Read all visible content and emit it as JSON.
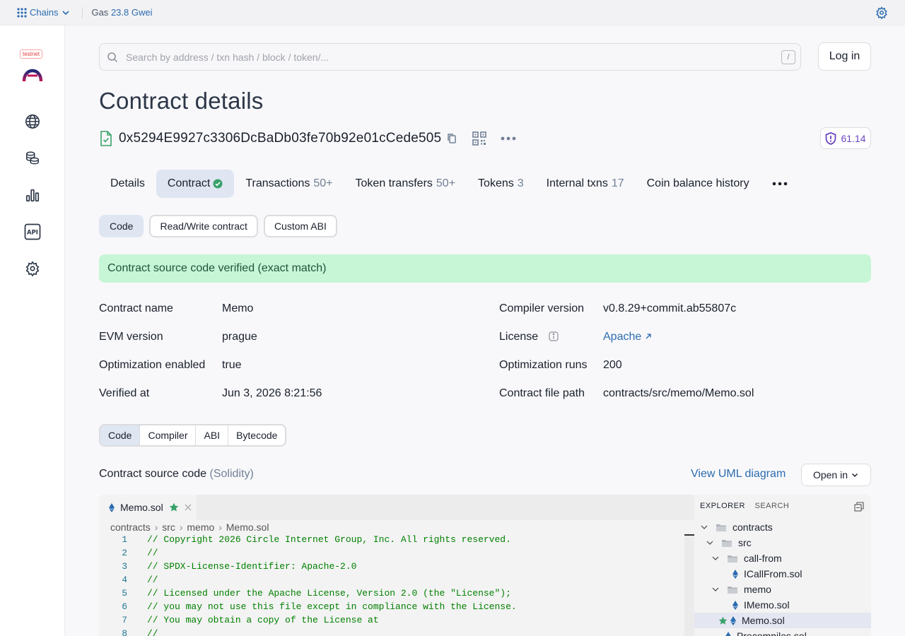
{
  "topbar": {
    "chains_label": "Chains",
    "gas_label": "Gas",
    "gas_value": "23.8 Gwei"
  },
  "sidebar": {
    "badge": "testnet"
  },
  "search": {
    "placeholder": "Search by address / txn hash / block / token/...",
    "shortcut": "/"
  },
  "header": {
    "login": "Log in",
    "title": "Contract details"
  },
  "contract": {
    "address": "0x5294E9927c3306DcBaDb03fe70b92e01cCede505",
    "score": "61.14"
  },
  "tabs": [
    {
      "label": "Details",
      "count": ""
    },
    {
      "label": "Contract",
      "count": ""
    },
    {
      "label": "Transactions",
      "count": "50+"
    },
    {
      "label": "Token transfers",
      "count": "50+"
    },
    {
      "label": "Tokens",
      "count": "3"
    },
    {
      "label": "Internal txns",
      "count": "17"
    },
    {
      "label": "Coin balance history",
      "count": ""
    }
  ],
  "subtabs": [
    "Code",
    "Read/Write contract",
    "Custom ABI"
  ],
  "verified_msg": "Contract source code verified (exact match)",
  "details": {
    "left": [
      {
        "k": "Contract name",
        "v": "Memo"
      },
      {
        "k": "EVM version",
        "v": "prague"
      },
      {
        "k": "Optimization enabled",
        "v": "true"
      },
      {
        "k": "Verified at",
        "v": "Jun 3, 2026 8:21:56"
      }
    ],
    "right": [
      {
        "k": "Compiler version",
        "v": "v0.8.29+commit.ab55807c"
      },
      {
        "k": "License",
        "v": "Apache"
      },
      {
        "k": "Optimization runs",
        "v": "200"
      },
      {
        "k": "Contract file path",
        "v": "contracts/src/memo/Memo.sol"
      }
    ]
  },
  "segments": [
    "Code",
    "Compiler",
    "ABI",
    "Bytecode"
  ],
  "source": {
    "title": "Contract source code",
    "lang": "(Solidity)",
    "uml": "View UML diagram",
    "open_in": "Open in"
  },
  "editor": {
    "tab": "Memo.sol",
    "breadcrumb": [
      "contracts",
      "src",
      "memo",
      "Memo.sol"
    ],
    "lines": [
      {
        "n": "1",
        "t": "// Copyright 2026 Circle Internet Group, Inc. All rights reserved."
      },
      {
        "n": "2",
        "t": "//"
      },
      {
        "n": "3",
        "t": "// SPDX-License-Identifier: Apache-2.0"
      },
      {
        "n": "4",
        "t": "//"
      },
      {
        "n": "5",
        "t": "// Licensed under the Apache License, Version 2.0 (the \"License\");"
      },
      {
        "n": "6",
        "t": "// you may not use this file except in compliance with the License."
      },
      {
        "n": "7",
        "t": "// You may obtain a copy of the License at"
      },
      {
        "n": "8",
        "t": "//"
      }
    ],
    "explorer_label": "EXPLORER",
    "search_label": "SEARCH",
    "tree": [
      "contracts",
      "src",
      "call-from",
      "ICallFrom.sol",
      "memo",
      "IMemo.sol",
      "Memo.sol",
      "Precompiles.sol"
    ]
  },
  "colors": {
    "accent": "#2b6cb0",
    "success_bg": "#c6f6d5",
    "active_tab": "#dfe6f2",
    "score": "#6b46c1"
  }
}
